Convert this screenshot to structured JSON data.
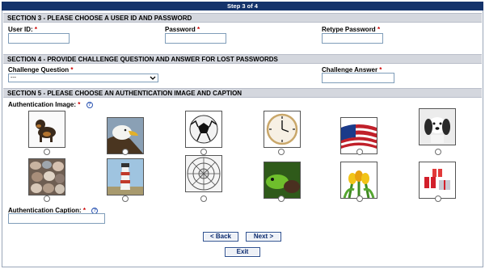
{
  "step": "Step 3 of 4",
  "section3": {
    "title": "SECTION 3 - PLEASE CHOOSE A USER ID AND PASSWORD",
    "user_id_label": "User ID:",
    "password_label": "Password",
    "retype_label": "Retype Password",
    "required_mark": "*"
  },
  "section4": {
    "title": "SECTION 4 - PROVIDE CHALLENGE QUESTION AND ANSWER FOR LOST PASSWORDS",
    "question_label": "Challenge Question",
    "question_value": "---",
    "answer_label": "Challenge Answer"
  },
  "section5": {
    "title": "SECTION 5 - PLEASE CHOOSE AN AUTHENTICATION IMAGE AND CAPTION",
    "image_label": "Authentication Image:",
    "caption_label": "Authentication Caption:",
    "help_icon": "?",
    "images": [
      "dog",
      "eagle",
      "soccer-ball",
      "clock",
      "flag",
      "puppy",
      "pebbles",
      "lighthouse",
      "dome",
      "chameleon",
      "tulips",
      "gifts"
    ]
  },
  "buttons": {
    "back": "< Back",
    "next": "Next >",
    "exit": "Exit"
  },
  "colors": {
    "header_bar": "#14336b",
    "section_bg": "#d4d7de",
    "required": "#cc0000",
    "button_text": "#0b2a6e"
  }
}
